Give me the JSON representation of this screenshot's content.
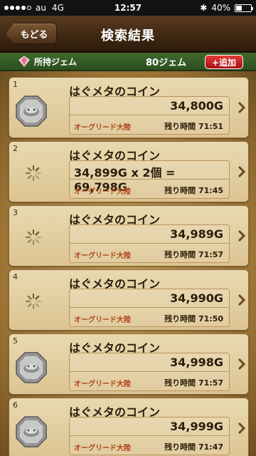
{
  "status_bar": {
    "carrier": "au",
    "network": "4G",
    "time": "12:57",
    "battery": "40%",
    "battery_level": 0.4,
    "signal_dots": 5,
    "signal_filled": 4
  },
  "header": {
    "back_label": "もどる",
    "title": "検索結果"
  },
  "gem_bar": {
    "label": "所持ジェム",
    "count": "80ジェム",
    "add_label": "+追加"
  },
  "colors": {
    "header": "#3e2712",
    "gem_bar": "#3f6a2f",
    "add_button": "#c4191c",
    "item_bg": "#e4d0a1",
    "region_text": "#b0441a"
  },
  "items": [
    {
      "index": "1",
      "name": "はぐメタのコイン",
      "price": "34,800G",
      "region": "オーグリード大陸",
      "remaining": "残り時間 71:51",
      "icon": "coin-icon"
    },
    {
      "index": "2",
      "name": "はぐメタのコイン",
      "price": "34,899G x 2個 = 69,798G",
      "region": "オーグリード大陸",
      "remaining": "残り時間 71:45",
      "icon": "loading-icon"
    },
    {
      "index": "3",
      "name": "はぐメタのコイン",
      "price": "34,989G",
      "region": "オーグリード大陸",
      "remaining": "残り時間 71:57",
      "icon": "loading-icon"
    },
    {
      "index": "4",
      "name": "はぐメタのコイン",
      "price": "34,990G",
      "region": "オーグリード大陸",
      "remaining": "残り時間 71:50",
      "icon": "loading-icon"
    },
    {
      "index": "5",
      "name": "はぐメタのコイン",
      "price": "34,998G",
      "region": "オーグリード大陸",
      "remaining": "残り時間 71:57",
      "icon": "coin-icon"
    },
    {
      "index": "6",
      "name": "はぐメタのコイン",
      "price": "34,999G",
      "region": "オーグリード大陸",
      "remaining": "残り時間 71:47",
      "icon": "coin-icon"
    }
  ]
}
